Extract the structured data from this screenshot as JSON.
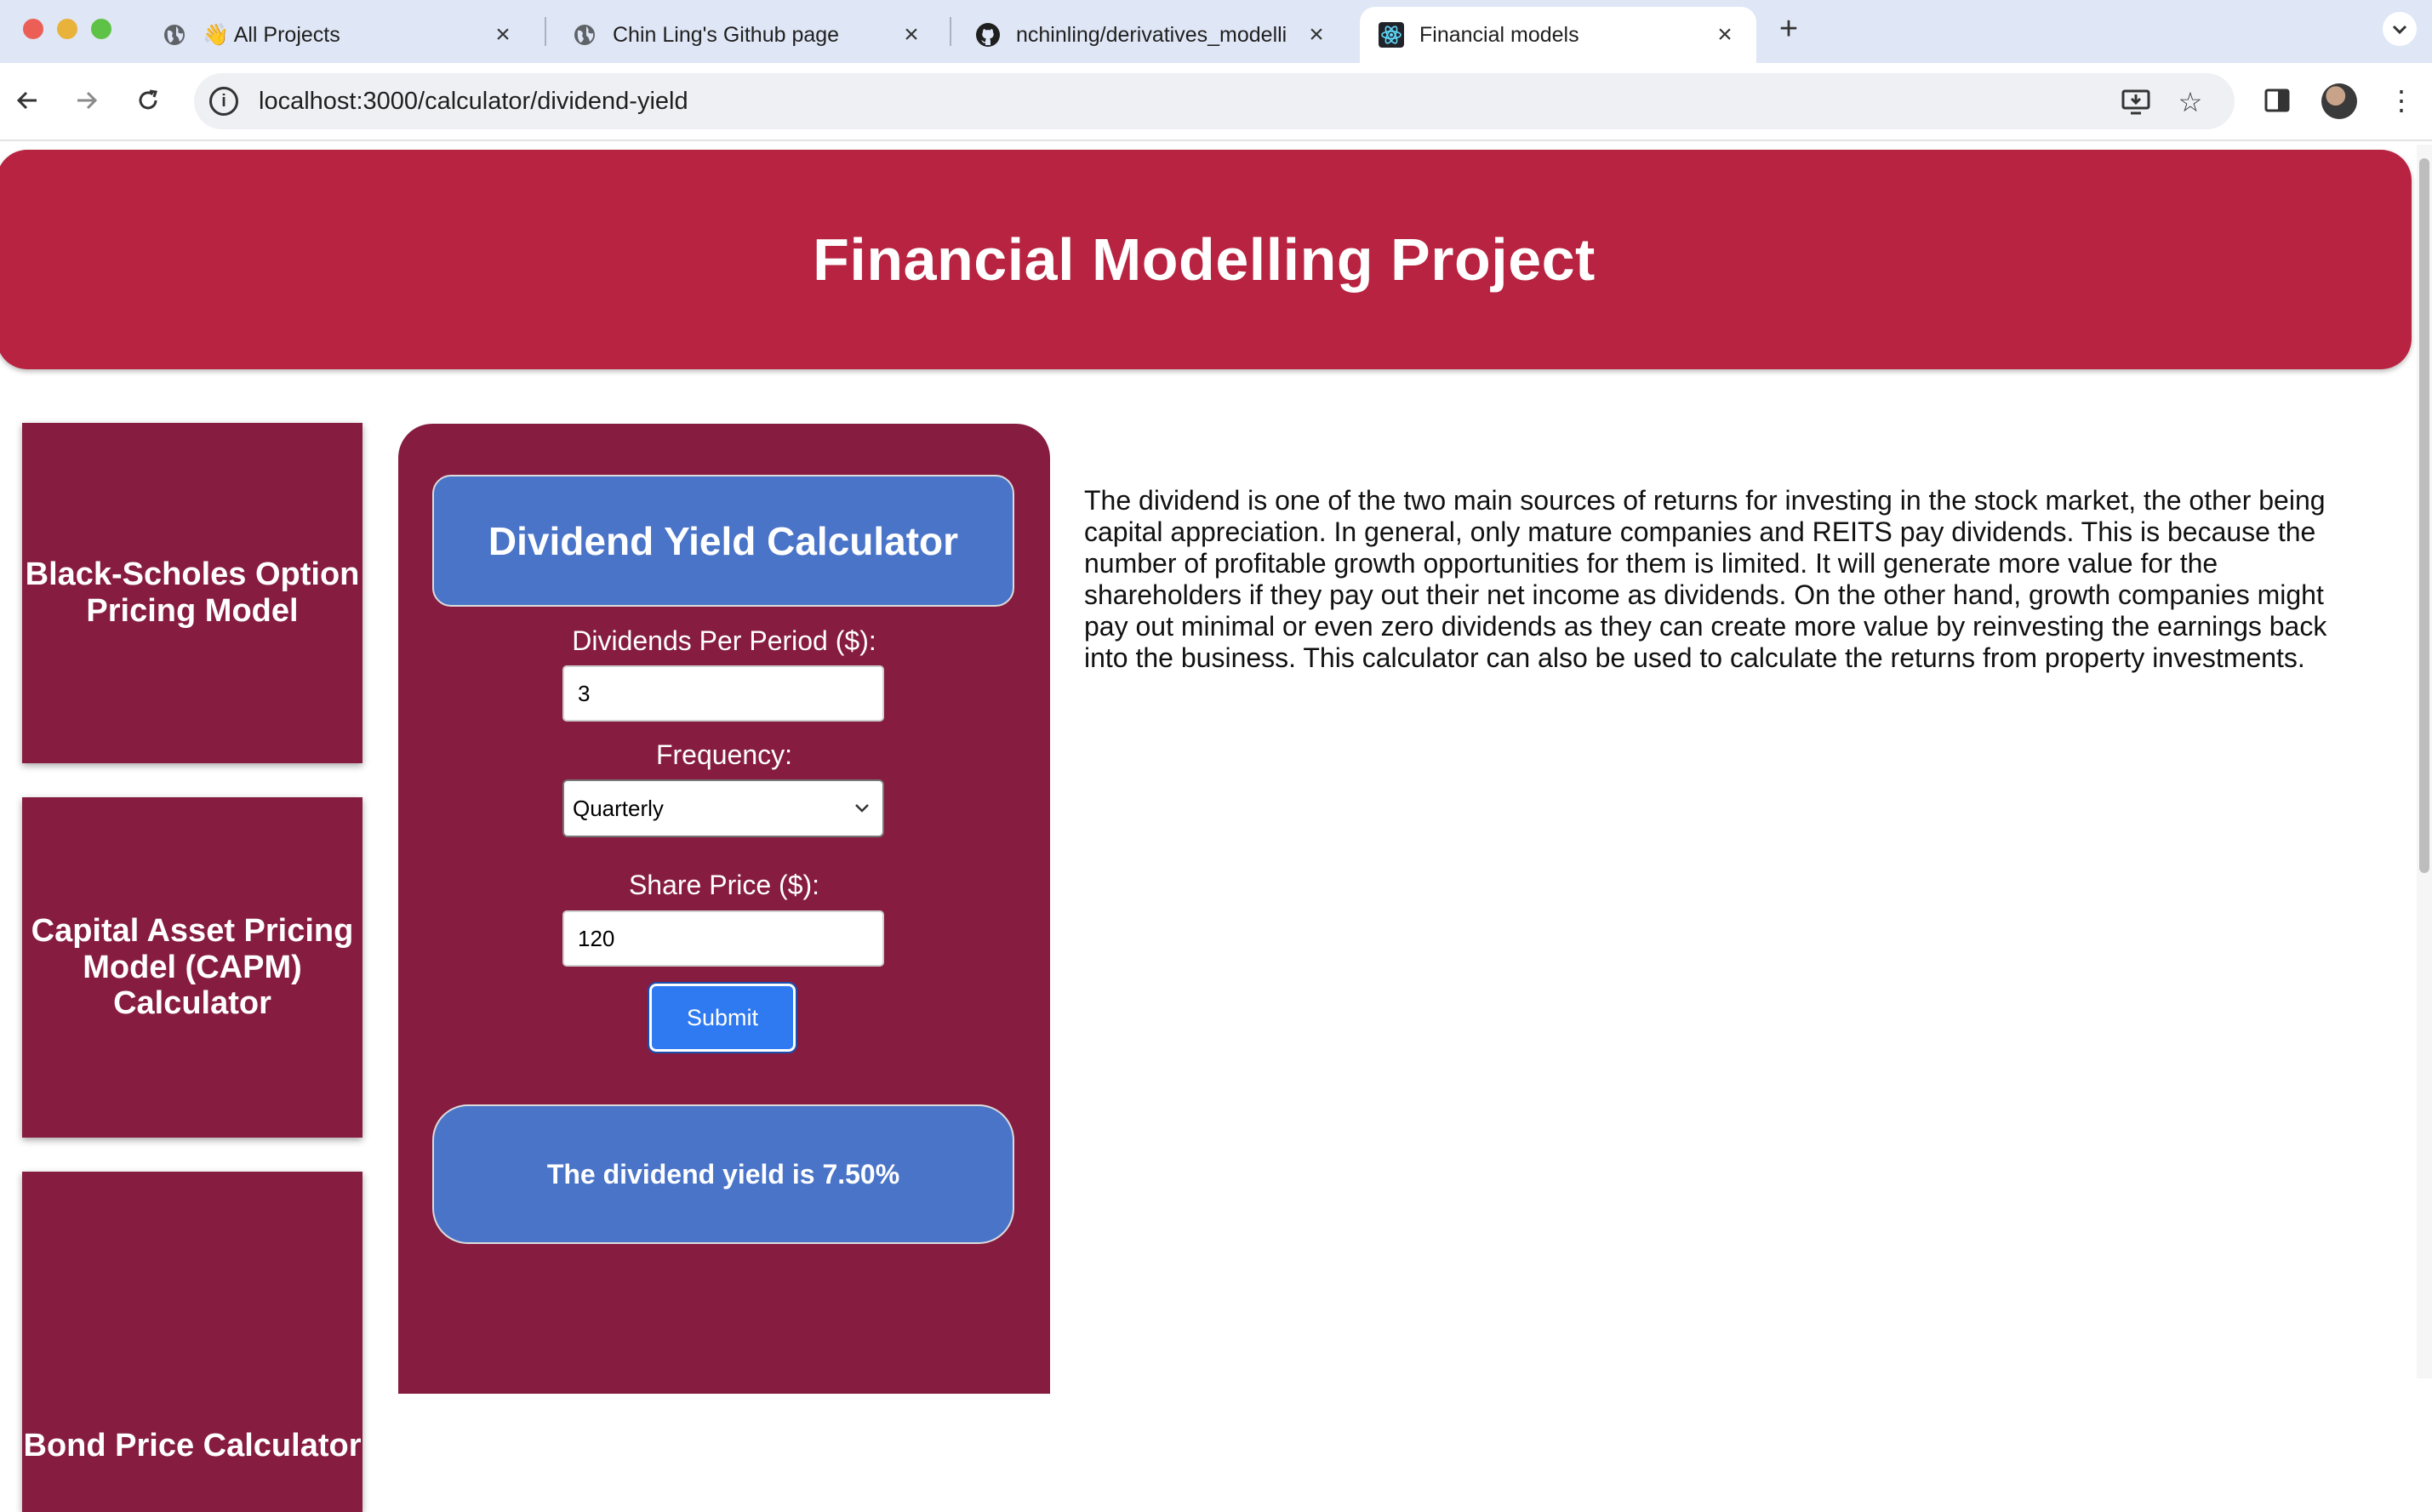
{
  "browser": {
    "tabs": [
      {
        "title": "👋 All Projects",
        "favicon": "globe-icon",
        "close": "×"
      },
      {
        "title": "Chin Ling's Github page",
        "favicon": "globe-icon",
        "close": "×"
      },
      {
        "title": "nchinling/derivatives_modelli",
        "favicon": "github-icon",
        "close": "×"
      },
      {
        "title": "Financial models",
        "favicon": "react-icon",
        "close": "×"
      }
    ],
    "new_tab": "+",
    "tab_menu": "⌄",
    "nav": {
      "back": "←",
      "forward": "→",
      "reload": "↻"
    },
    "url": "localhost:3000/calculator/dividend-yield",
    "info_icon": "i",
    "install": "⤓",
    "bookmark": "☆",
    "sidepanel": "▯",
    "menu": "⋮"
  },
  "header": {
    "title": "Financial Modelling Project"
  },
  "sidebar": {
    "items": [
      {
        "label": "Black-Scholes Option Pricing Model"
      },
      {
        "label": "Capital Asset Pricing Model (CAPM) Calculator"
      },
      {
        "label": "Bond Price Calculator"
      }
    ]
  },
  "calculator": {
    "title": "Dividend Yield Calculator",
    "fields": {
      "dividends_label": "Dividends Per Period ($):",
      "dividends_value": "3",
      "frequency_label": "Frequency:",
      "frequency_value": "Quarterly",
      "share_price_label": "Share Price ($):",
      "share_price_value": "120"
    },
    "submit_label": "Submit",
    "result": "The dividend yield is 7.50%"
  },
  "description": "The dividend is one of the two main sources of returns for investing in the stock market, the other being capital appreciation. In general, only mature companies and REITS pay dividends. This is because the number of profitable growth opportunities for them is limited. It will generate more value for the shareholders if they pay out their net income as dividends. On the other hand, growth companies might pay out minimal or even zero dividends as they can create more value by reinvesting the earnings back into the business. This calculator can also be used to calculate the returns from property investments.",
  "colors": {
    "banner": "#b72340",
    "card": "#861c3f",
    "accent_blue": "#4a74c8",
    "submit_blue": "#2f7af1"
  }
}
